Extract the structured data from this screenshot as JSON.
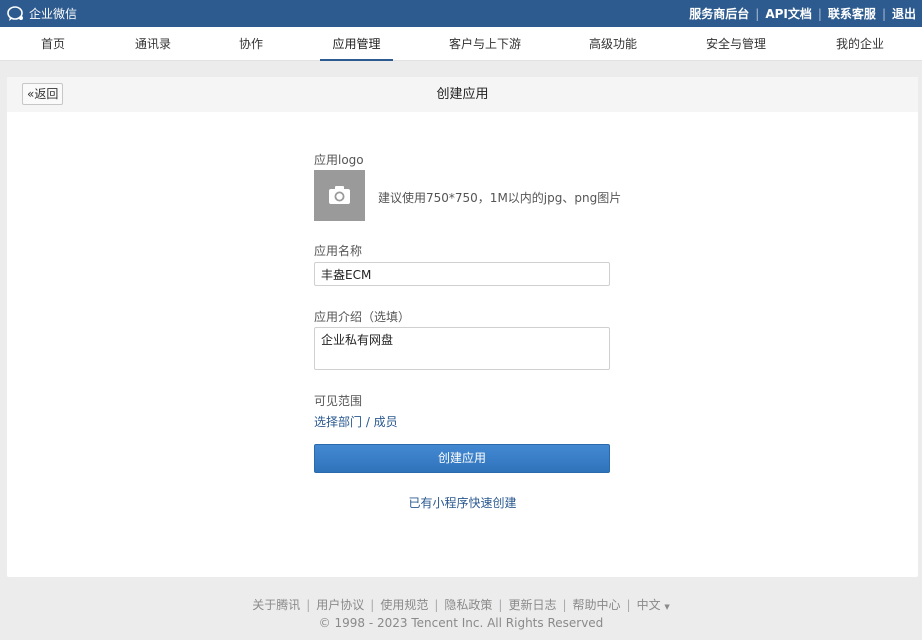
{
  "topbar": {
    "brand": "企业微信",
    "links": [
      "服务商后台",
      "API文档",
      "联系客服",
      "退出"
    ]
  },
  "nav": {
    "items": [
      "首页",
      "通讯录",
      "协作",
      "应用管理",
      "客户与上下游",
      "高级功能",
      "安全与管理",
      "我的企业"
    ],
    "active": "应用管理"
  },
  "page": {
    "back": "«返回",
    "title": "创建应用"
  },
  "form": {
    "logo_label": "应用logo",
    "logo_hint": "建议使用750*750，1M以内的jpg、png图片",
    "name_label": "应用名称",
    "name_value": "丰盎ECM",
    "intro_label": "应用介绍（选填）",
    "intro_value": "企业私有网盘",
    "scope_label": "可见范围",
    "scope_link": "选择部门 / 成员",
    "submit": "创建应用",
    "mini_link": "已有小程序快速创建"
  },
  "footer": {
    "links": [
      "关于腾讯",
      "用户协议",
      "使用规范",
      "隐私政策",
      "更新日志",
      "帮助中心",
      "中文"
    ],
    "lang_caret": "▼",
    "copyright": "© 1998 - 2023 Tencent Inc. All Rights Reserved"
  },
  "colors": {
    "topbar": "#2e5b8f",
    "primary": "#3a7fc7",
    "link": "#2a5990",
    "page_bg": "#ececed"
  }
}
